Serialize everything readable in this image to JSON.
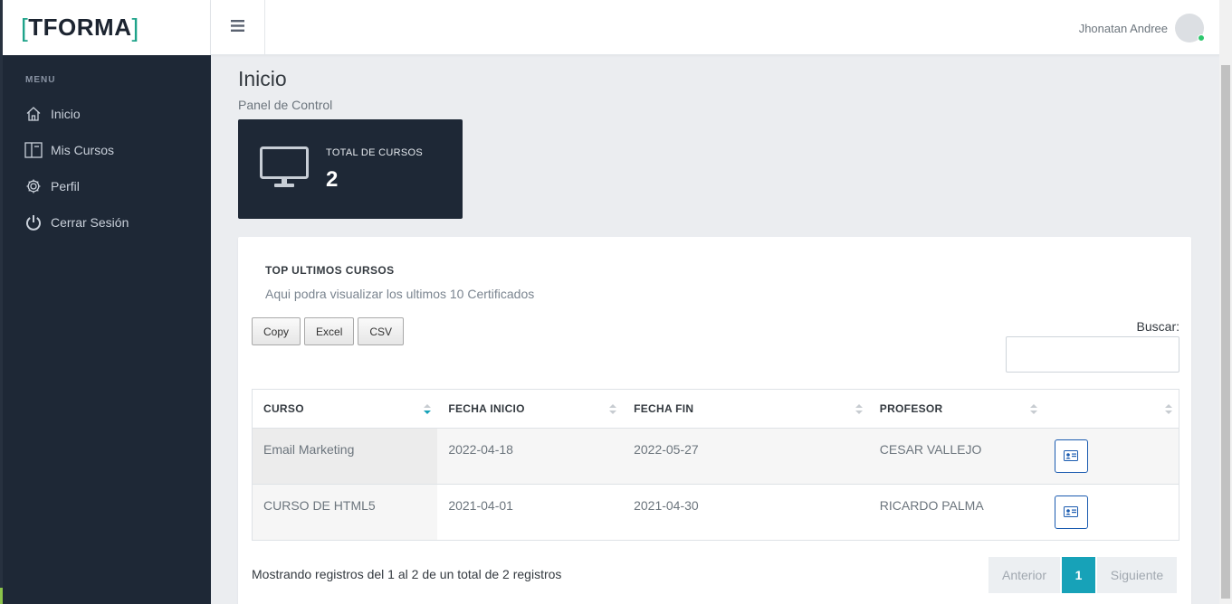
{
  "brand": {
    "logo_text": "TFORMA",
    "bracket_left": "[",
    "bracket_right": "]"
  },
  "sidebar": {
    "menu_label": "MENU",
    "items": [
      {
        "label": "Inicio",
        "icon": "home-icon"
      },
      {
        "label": "Mis Cursos",
        "icon": "book-icon"
      },
      {
        "label": "Perfil",
        "icon": "gear-icon"
      },
      {
        "label": "Cerrar Sesión",
        "icon": "power-icon"
      }
    ]
  },
  "topbar": {
    "user_name": "Jhonatan Andree",
    "status_color": "#2dc76d"
  },
  "page": {
    "title": "Inicio",
    "subtitle": "Panel de Control"
  },
  "stat": {
    "label": "TOTAL DE CURSOS",
    "value": "2",
    "icon": "monitor-icon"
  },
  "card": {
    "title": "TOP ULTIMOS CURSOS",
    "subtitle": "Aqui podra visualizar los ultimos 10 Certificados",
    "buttons": [
      "Copy",
      "Excel",
      "CSV"
    ],
    "search_label": "Buscar:",
    "search_value": ""
  },
  "table": {
    "columns": [
      "CURSO",
      "FECHA INICIO",
      "FECHA FIN",
      "PROFESOR",
      ""
    ],
    "rows": [
      {
        "curso": "Email Marketing",
        "inicio": "2022-04-18",
        "fin": "2022-05-27",
        "profesor": "CESAR VALLEJO",
        "action_icon": "id-card-icon"
      },
      {
        "curso": "CURSO DE HTML5",
        "inicio": "2021-04-01",
        "fin": "2021-04-30",
        "profesor": "RICARDO PALMA",
        "action_icon": "id-card-icon"
      }
    ]
  },
  "footer": {
    "info": "Mostrando registros del 1 al 2 de un total de 2 registros",
    "prev": "Anterior",
    "page": "1",
    "next": "Siguiente"
  },
  "colors": {
    "sidebar_bg": "#1e2836",
    "accent": "#17a2b8",
    "brand_bracket": "#1fa38a",
    "action_border": "#1a5bb0"
  }
}
